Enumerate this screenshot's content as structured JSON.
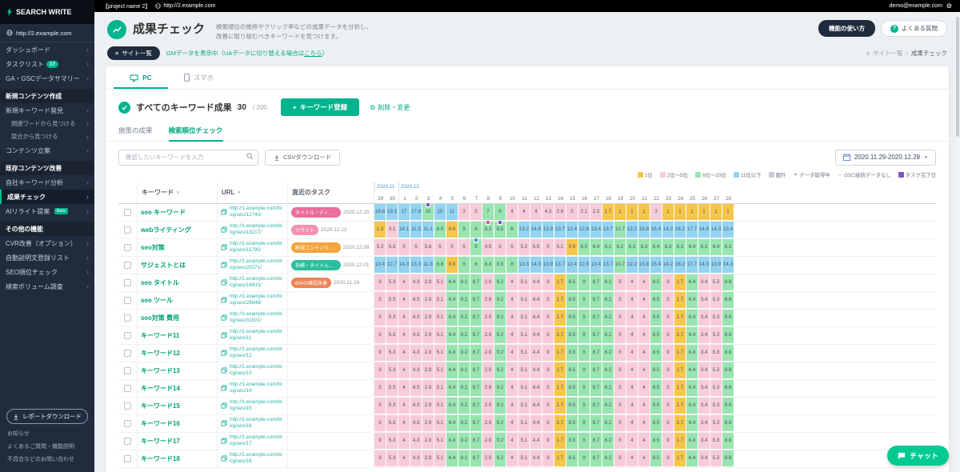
{
  "colors": {
    "accent": "#00b48d",
    "sidebar_bg": "#202c3d",
    "rank1": "#f5c64a",
    "rank2_5": "#f8cbd9",
    "rank6_10": "#98e5b0",
    "rank11": "#92d4f2",
    "out": "#c9ced6"
  },
  "topbar": {
    "project": "【project name 2】",
    "url": "http://2.example.com",
    "account": "demo@example.com"
  },
  "sidebar": {
    "logo": "SEARCH WRITE",
    "site": "http://2.example.com",
    "nav": [
      {
        "label": "ダッシュボード"
      },
      {
        "label": "タスクリスト",
        "badge": "17"
      },
      {
        "label": "GA・GSCデータサマリー"
      }
    ],
    "sections": [
      {
        "title": "新規コンテンツ作成",
        "items": [
          {
            "label": "新規キーワード発見"
          },
          {
            "label": "関連ワードから見つける",
            "sub": true
          },
          {
            "label": "競合から見つける",
            "sub": true
          },
          {
            "label": "コンテンツ立案"
          }
        ]
      },
      {
        "title": "既存コンテンツ改善",
        "items": [
          {
            "label": "自社キーワード分析"
          },
          {
            "label": "成果チェック",
            "active": true
          },
          {
            "label": "AIリライト提案",
            "beta": "Beta"
          }
        ]
      },
      {
        "title": "その他の機能",
        "items": [
          {
            "label": "CVR改善（オプション）"
          },
          {
            "label": "自動説明文登録リスト"
          },
          {
            "label": "SEO順位チェック"
          },
          {
            "label": "検索ボリューム調査"
          }
        ]
      }
    ],
    "report_button": "レポートダウンロード",
    "footer_links": [
      "お知らせ",
      "よくあるご質問・機能説明",
      "不具合などのお問い合わせ"
    ]
  },
  "header": {
    "title": "成果チェック",
    "desc1": "検索順位の推移やクリック率などの成果データを分析し、",
    "desc2": "改善に取り組むべきキーワードを見つけます。",
    "howto": "機能の使い方",
    "faq": "よくある質問"
  },
  "subbar": {
    "site_list": "サイト一覧",
    "gm_pre": "GMデータを表示中（UAデータに切り替える場合は",
    "gm_link": "こちら",
    "gm_post": "）",
    "bc_parent": "サイト一覧",
    "bc_current": "成果チェック"
  },
  "card": {
    "tabs": [
      {
        "label": "PC",
        "active": true
      },
      {
        "label": "スマホ",
        "active": false
      }
    ],
    "section_title": "すべてのキーワード成果",
    "count": "30",
    "count_total": "/ 200",
    "register_label": "キーワード登録",
    "edit_label": "削除・変更",
    "subtabs": [
      {
        "label": "施策の成果",
        "active": false
      },
      {
        "label": "検索順位チェック",
        "active": true
      }
    ],
    "search_placeholder": "確認したいキーワードを入力",
    "csv_label": "CSVダウンロード",
    "date_range": "2020.11.29-2020.12.28",
    "legend": [
      {
        "label": "1位",
        "color": "#f5c64a"
      },
      {
        "label": "2位～5位",
        "color": "#f8cbd9"
      },
      {
        "label": "6位～10位",
        "color": "#98e5b0"
      },
      {
        "label": "11位以下",
        "color": "#92d4f2"
      },
      {
        "label": "圏外",
        "color": "#c9ced6"
      },
      {
        "label": "データ取得中",
        "type": "triangle"
      },
      {
        "label": "GSC接続データなし",
        "type": "dash"
      },
      {
        "label": "タスク完了日",
        "type": "flag",
        "color": "#7e57c2"
      }
    ]
  },
  "table": {
    "col_headers": {
      "keyword": "キーワード",
      "url": "URL",
      "task": "直近のタスク"
    },
    "months": [
      {
        "label": "2020.11",
        "span": 2
      },
      {
        "label": "2020.12",
        "span": 28
      }
    ],
    "days": [
      "29",
      "30",
      "1",
      "2",
      "3",
      "4",
      "5",
      "6",
      "7",
      "8",
      "9",
      "10",
      "11",
      "12",
      "13",
      "14",
      "15",
      "16",
      "17",
      "18",
      "19",
      "20",
      "21",
      "22",
      "23",
      "24",
      "25",
      "26",
      "27",
      "28"
    ],
    "rows": [
      {
        "keyword": "seo キーワード",
        "url": "http://1.example.com/blog/seo/12740/",
        "task": {
          "label": "タイトル・ディス…",
          "color": "#ea6d9e",
          "date": "2020.12.20"
        },
        "markers": [
          {
            "i": 4,
            "color": "#7e57c2"
          }
        ],
        "values": [
          19.8,
          19.3,
          17,
          17.8,
          10,
          15,
          11,
          3,
          3,
          7,
          9,
          4,
          4,
          4,
          4.3,
          2.9,
          2,
          2.1,
          2.3,
          1.7,
          1,
          1,
          1,
          3,
          1,
          1,
          1,
          1,
          1,
          1
        ]
      },
      {
        "keyword": "webライティング",
        "url": "http://1.example.com/blog/seo/13217/",
        "task": {
          "label": "リライト",
          "color": "#f291b4",
          "date": "2020.12.12"
        },
        "markers": [
          {
            "i": 9,
            "color": "#e0559b"
          },
          {
            "i": 10,
            "color": "#7e57c2"
          }
        ],
        "values": [
          1.3,
          3.1,
          14.1,
          11.3,
          11.1,
          8.8,
          0.6,
          9,
          6,
          8.3,
          8.5,
          6,
          13.2,
          14.9,
          13.9,
          13.7,
          12.4,
          12.8,
          13.4,
          13.7,
          10.7,
          12.2,
          15.8,
          15.4,
          14.2,
          16.2,
          17.7,
          14.9,
          14.3,
          13.4
        ]
      },
      {
        "keyword": "seo対策",
        "url": "http://1.example.com/blog/seo/11795/",
        "task": {
          "label": "新規コンテンツ作成",
          "color": "#f5a33c",
          "date": "2020.12.08"
        },
        "markers": [
          {
            "i": 8,
            "color": "#4a90d9"
          }
        ],
        "values": [
          5.3,
          5.3,
          5,
          5,
          5.6,
          5,
          5,
          5,
          9,
          4.5,
          3,
          5,
          5.2,
          5.5,
          5,
          5.1,
          0.6,
          6.5,
          6.4,
          6.1,
          6.2,
          6.3,
          6.3,
          6.4,
          6.3,
          6.3,
          6.4,
          6.3,
          6.4,
          6.3
        ]
      },
      {
        "keyword": "サジェストとは",
        "url": "http://1.example.com/blog/seo/20271/",
        "task": {
          "label": "指標・タイトル・…",
          "color": "#2bbf9e",
          "date": "2020.12.01"
        },
        "markers": [],
        "values": [
          13.4,
          12.7,
          14.3,
          13.3,
          11.3,
          8.8,
          0.6,
          9,
          6,
          8.3,
          8.5,
          8,
          13.3,
          14.9,
          13.9,
          13.7,
          12.4,
          12.8,
          13.4,
          13.7,
          10.7,
          12.2,
          15.8,
          15.4,
          14.2,
          16.2,
          17.7,
          14.9,
          13.9,
          14.3
        ]
      },
      {
        "keyword": "seo タイトル",
        "url": "http://1.example.com/blog/seo/14833/",
        "task": {
          "label": "604の確認改善",
          "color": "#ef8354",
          "date": "2020.11.18"
        },
        "markers": [],
        "values": [
          3,
          5.3,
          4,
          4.3,
          2.9,
          5.1,
          6.4,
          9.2,
          8.7,
          2.9,
          9.2,
          4,
          5.1,
          4.4,
          3,
          1.7,
          8.5,
          9,
          8.7,
          6.2,
          5,
          4,
          4,
          8.5,
          3,
          1.7,
          6.4,
          3.4,
          5.3,
          8.8
        ]
      },
      {
        "keyword": "seo ツール",
        "url": "http://1.example.com/blog/seo/28848/",
        "task": null,
        "markers": [],
        "values": [
          3,
          5.3,
          4,
          4.3,
          2.9,
          5.1,
          6.4,
          9.2,
          8.7,
          2.9,
          9.2,
          4,
          5.1,
          4.4,
          3,
          1.7,
          8.5,
          9,
          8.7,
          6.2,
          5,
          4,
          4,
          8.5,
          3,
          1.7,
          6.4,
          3.4,
          5.3,
          8.8
        ]
      },
      {
        "keyword": "seo対策 費用",
        "url": "http://1.example.com/blog/seo/31501/",
        "task": null,
        "markers": [],
        "values": [
          3,
          5.3,
          4,
          4.3,
          2.9,
          5.1,
          6.4,
          9.2,
          8.7,
          2.9,
          9.2,
          4,
          5.1,
          4.4,
          3,
          1.7,
          8.5,
          9,
          8.7,
          6.2,
          5,
          4,
          4,
          8.5,
          3,
          1.7,
          6.4,
          3.4,
          5.3,
          8.8
        ]
      },
      {
        "keyword": "キーワード11",
        "url": "http://1.example.com/blog/seo/11",
        "task": null,
        "markers": [],
        "values": [
          3,
          5.3,
          4,
          4.3,
          2.9,
          5.1,
          6.4,
          9.2,
          8.7,
          2.9,
          9.2,
          4,
          5.1,
          4.4,
          3,
          1.7,
          8.5,
          9,
          8.7,
          6.2,
          5,
          4,
          4,
          8.5,
          3,
          1.7,
          6.4,
          3.4,
          5.3,
          8.8
        ]
      },
      {
        "keyword": "キーワード12",
        "url": "http://1.example.com/blog/seo/12",
        "task": null,
        "markers": [],
        "values": [
          3,
          5.3,
          4,
          4.3,
          2.9,
          5.1,
          6.4,
          9.2,
          8.7,
          2.9,
          9.2,
          4,
          5.1,
          4.4,
          3,
          1.7,
          8.5,
          9,
          8.7,
          6.2,
          5,
          4,
          4,
          8.5,
          3,
          1.7,
          6.4,
          3.4,
          5.3,
          8.8
        ]
      },
      {
        "keyword": "キーワード13",
        "url": "http://1.example.com/blog/seo/13",
        "task": null,
        "markers": [],
        "values": [
          3,
          5.3,
          4,
          4.3,
          2.9,
          5.1,
          6.4,
          9.2,
          8.7,
          2.9,
          9.2,
          4,
          5.1,
          4.4,
          3,
          1.7,
          8.5,
          9,
          8.7,
          6.2,
          5,
          4,
          4,
          8.5,
          3,
          1.7,
          6.4,
          3.4,
          5.3,
          8.8
        ]
      },
      {
        "keyword": "キーワード14",
        "url": "http://1.example.com/blog/seo/14",
        "task": null,
        "markers": [],
        "values": [
          3,
          5.3,
          4,
          4.3,
          2.9,
          5.1,
          6.4,
          9.2,
          8.7,
          2.9,
          9.2,
          4,
          5.1,
          4.4,
          3,
          1.7,
          8.5,
          9,
          8.7,
          6.2,
          5,
          4,
          4,
          8.5,
          3,
          1.7,
          6.4,
          3.4,
          5.3,
          8.8
        ]
      },
      {
        "keyword": "キーワード15",
        "url": "http://1.example.com/blog/seo/15",
        "task": null,
        "markers": [],
        "values": [
          3,
          5.3,
          4,
          4.3,
          2.9,
          5.1,
          6.4,
          9.2,
          8.7,
          2.9,
          9.2,
          4,
          5.1,
          4.4,
          3,
          1.7,
          8.5,
          9,
          8.7,
          6.2,
          5,
          4,
          4,
          8.5,
          3,
          1.7,
          6.4,
          3.4,
          5.3,
          8.8
        ]
      },
      {
        "keyword": "キーワード16",
        "url": "http://1.example.com/blog/seo/16",
        "task": null,
        "markers": [],
        "values": [
          3,
          5.3,
          4,
          4.3,
          2.9,
          5.1,
          6.4,
          9.2,
          8.7,
          2.9,
          9.2,
          4,
          5.1,
          4.4,
          3,
          1.7,
          8.5,
          9,
          8.7,
          6.2,
          5,
          4,
          4,
          8.5,
          3,
          1.7,
          6.4,
          3.4,
          5.3,
          8.8
        ]
      },
      {
        "keyword": "キーワード17",
        "url": "http://1.example.com/blog/seo/17",
        "task": null,
        "markers": [],
        "values": [
          3,
          5.3,
          4,
          4.3,
          2.9,
          5.1,
          6.4,
          9.2,
          8.7,
          2.9,
          9.2,
          4,
          5.1,
          4.4,
          3,
          1.7,
          8.5,
          9,
          8.7,
          6.2,
          5,
          4,
          4,
          8.5,
          3,
          1.7,
          6.4,
          3.4,
          5.3,
          8.8
        ]
      },
      {
        "keyword": "キーワード18",
        "url": "http://1.example.com/blog/seo/18",
        "task": null,
        "markers": [],
        "values": [
          3,
          5.3,
          4,
          4.3,
          2.9,
          5.1,
          6.4,
          9.2,
          8.7,
          2.9,
          9.2,
          4,
          5.1,
          4.4,
          3,
          1.7,
          8.5,
          9,
          8.7,
          6.2,
          5,
          4,
          4,
          8.5,
          3,
          1.7,
          6.4,
          3.4,
          5.3,
          8.8
        ]
      }
    ]
  },
  "chat": {
    "label": "チャット"
  }
}
